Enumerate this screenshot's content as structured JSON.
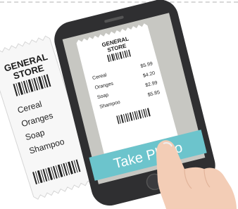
{
  "paper_receipt": {
    "store_name_line1": "GENERAL",
    "store_name_line2": "STORE",
    "items": [
      "Cereal",
      "Oranges",
      "Soap",
      "Shampoo"
    ]
  },
  "phone_screen_receipt": {
    "store_name_line1": "GENERAL",
    "store_name_line2": "STORE",
    "items": [
      {
        "name": "Cereal",
        "price": "$5.99"
      },
      {
        "name": "Oranges",
        "price": "$4.20"
      },
      {
        "name": "Soap",
        "price": "$2.99"
      },
      {
        "name": "Shampoo",
        "price": "$5.85"
      }
    ]
  },
  "take_photo_label": "Take Photo",
  "colors": {
    "phone_body": "#2f2f31",
    "screen_bg": "#c7c7c2",
    "take_photo_bar": "#6cc4cc",
    "paper": "#f7f7f7",
    "hand": "#f3cdb6"
  }
}
